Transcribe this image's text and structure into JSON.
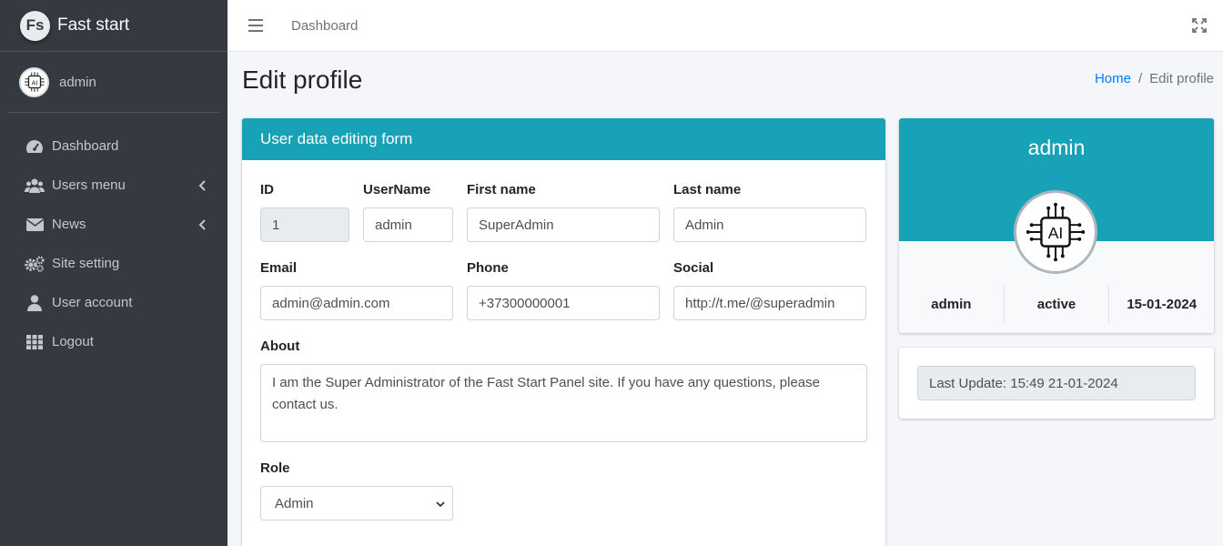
{
  "brand": {
    "logo_text": "Fs",
    "name": "Fast start"
  },
  "user_panel": {
    "name": "admin",
    "avatar_icon": "ai-chip-icon"
  },
  "sidebar": {
    "items": [
      {
        "label": "Dashboard",
        "icon": "tachometer-icon",
        "has_submenu": false
      },
      {
        "label": "Users menu",
        "icon": "users-icon",
        "has_submenu": true
      },
      {
        "label": "News",
        "icon": "envelope-icon",
        "has_submenu": true
      },
      {
        "label": "Site setting",
        "icon": "cogs-icon",
        "has_submenu": false
      },
      {
        "label": "User account",
        "icon": "user-icon",
        "has_submenu": false
      },
      {
        "label": "Logout",
        "icon": "grid-icon",
        "has_submenu": false
      }
    ]
  },
  "header": {
    "nav_link": "Dashboard"
  },
  "page": {
    "title": "Edit profile",
    "breadcrumb": {
      "home": "Home",
      "separator": "/",
      "current": "Edit profile"
    }
  },
  "form": {
    "title": "User data editing form",
    "id": {
      "label": "ID",
      "value": "1"
    },
    "username": {
      "label": "UserName",
      "value": "admin"
    },
    "first_name": {
      "label": "First name",
      "value": "SuperAdmin"
    },
    "last_name": {
      "label": "Last name",
      "value": "Admin"
    },
    "email": {
      "label": "Email",
      "value": "admin@admin.com"
    },
    "phone": {
      "label": "Phone",
      "value": "+37300000001"
    },
    "social": {
      "label": "Social",
      "value": "http://t.me/@superadmin"
    },
    "about": {
      "label": "About",
      "value": "I am the Super Administrator of the Fast Start Panel site. If you have any questions, please contact us."
    },
    "role": {
      "label": "Role",
      "value": "Admin"
    }
  },
  "profile": {
    "name": "admin",
    "avatar_text": "AI",
    "stats": {
      "username": "admin",
      "status": "active",
      "date": "15-01-2024"
    },
    "last_update": "Last Update: 15:49 21-01-2024"
  },
  "colors": {
    "sidebar_bg": "#343a40",
    "accent": "#17a2b8",
    "link": "#007bff"
  }
}
